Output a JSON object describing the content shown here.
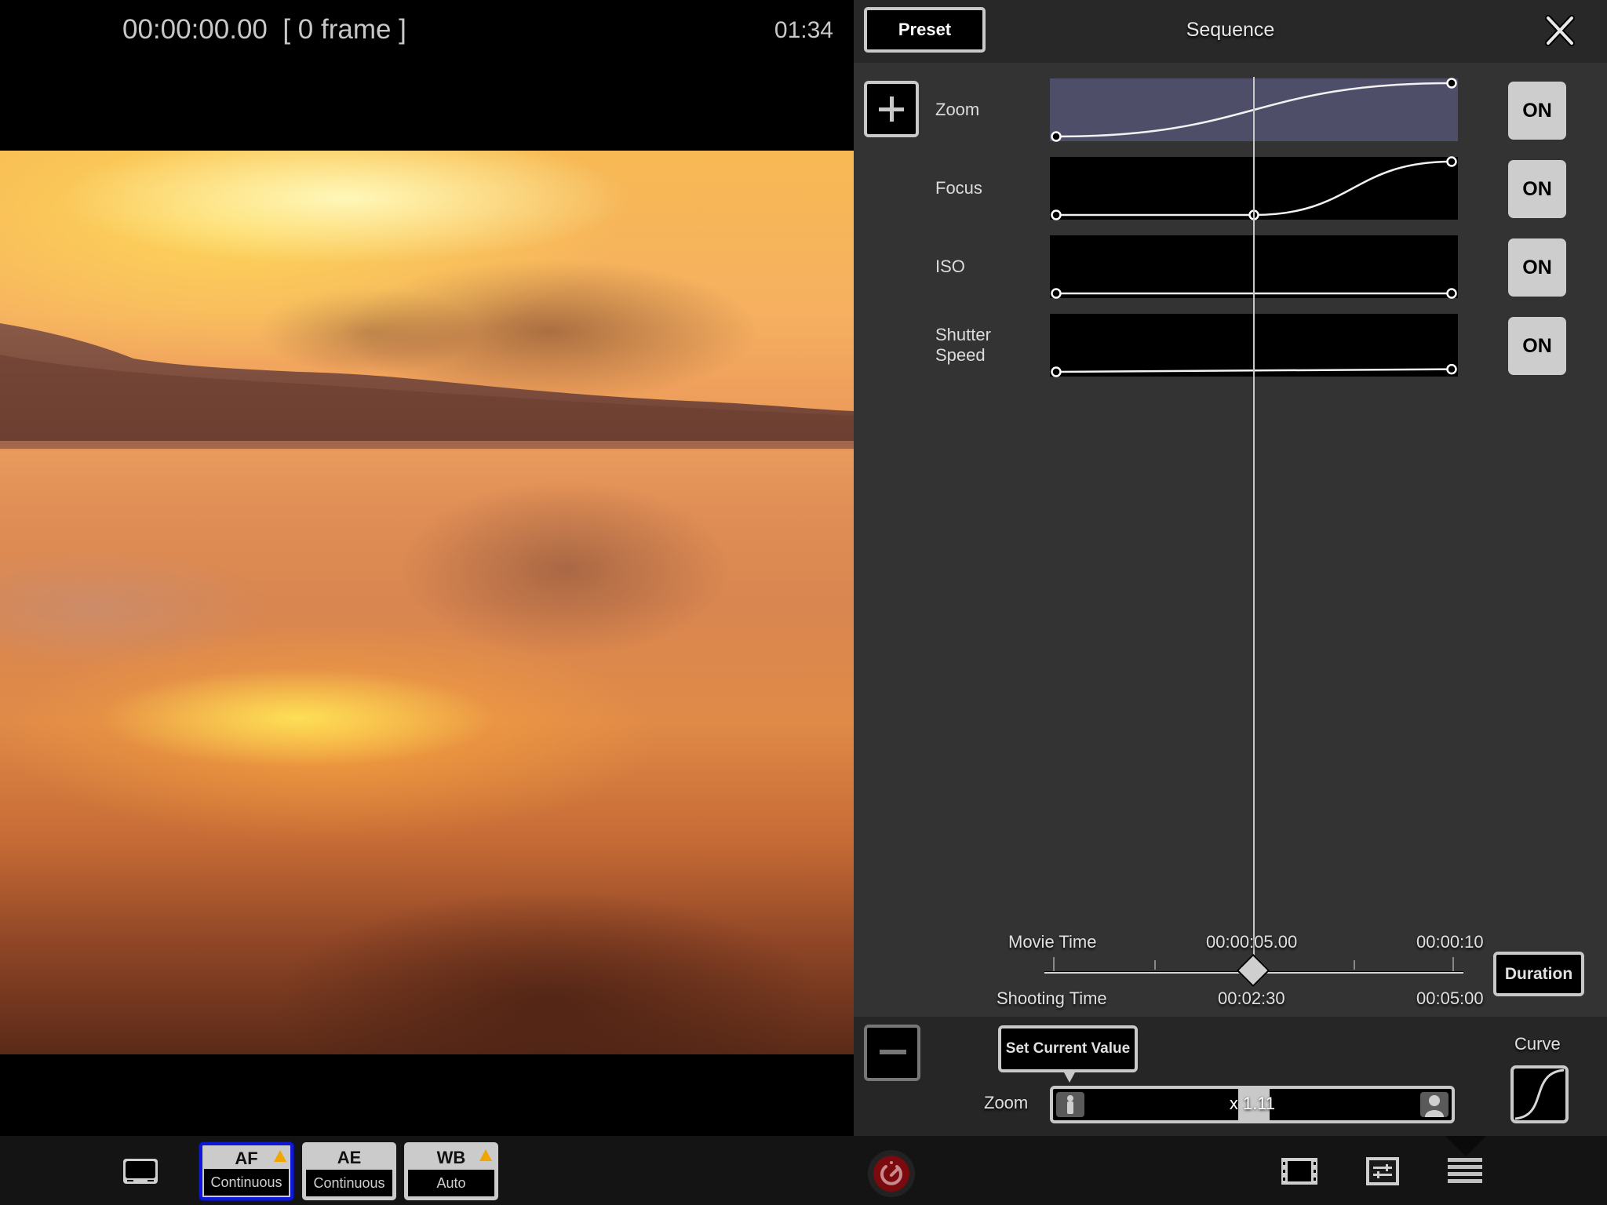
{
  "viewfinder": {
    "timecode": "00:00:00.00",
    "frame_count": "[ 0 frame ]",
    "remaining_time": "01:34",
    "image_description": "sunset over lake with forested hills and reflections"
  },
  "panel": {
    "title": "Sequence",
    "preset_label": "Preset",
    "close_icon": "close-icon",
    "add_icon": "plus-icon",
    "tracks": [
      {
        "label": "Zoom",
        "toggle": "ON",
        "selected": true,
        "keyframes": [
          {
            "t": 0.0,
            "v": 0.0
          },
          {
            "t": 1.0,
            "v": 1.0
          }
        ],
        "curve": "ease-in-out"
      },
      {
        "label": "Focus",
        "toggle": "ON",
        "selected": false,
        "keyframes": [
          {
            "t": 0.0,
            "v": 0.0
          },
          {
            "t": 0.5,
            "v": 0.0
          },
          {
            "t": 1.0,
            "v": 1.0
          }
        ],
        "curve": "ease-in-out"
      },
      {
        "label": "ISO",
        "toggle": "ON",
        "selected": false,
        "keyframes": [
          {
            "t": 0.0,
            "v": 0.0
          },
          {
            "t": 1.0,
            "v": 0.0
          }
        ],
        "curve": "linear"
      },
      {
        "label_line1": "Shutter",
        "label_line2": "Speed",
        "label": "Shutter Speed",
        "toggle": "ON",
        "selected": false,
        "keyframes": [
          {
            "t": 0.0,
            "v": 0.0
          },
          {
            "t": 1.0,
            "v": 0.05
          }
        ],
        "curve": "linear"
      }
    ],
    "playhead_position": 0.5,
    "timeline": {
      "movie_time_label": "Movie Time",
      "movie_time_current": "00:00:05.00",
      "movie_time_end": "00:00:10",
      "shooting_time_label": "Shooting Time",
      "shooting_time_current": "00:02:30",
      "shooting_time_end": "00:05:00",
      "duration_label": "Duration"
    },
    "controls": {
      "remove_icon": "minus-icon",
      "set_current_label": "Set Current Value",
      "param_label": "Zoom",
      "zoom_value": "x 1.11",
      "zoom_slider_position": 0.5,
      "curve_label": "Curve",
      "curve_icon": "s-curve-icon"
    }
  },
  "bottombar": {
    "monitor_icon": "monitor-icon",
    "modes": [
      {
        "name": "AF",
        "value": "Continuous",
        "warning": true,
        "active": true
      },
      {
        "name": "AE",
        "value": "Continuous",
        "warning": false,
        "active": false
      },
      {
        "name": "WB",
        "value": "Auto",
        "warning": true,
        "active": false
      }
    ],
    "record_icon": "timer-record-icon",
    "right_icons": [
      "film-icon",
      "settings-sliders-icon",
      "menu-icon"
    ]
  },
  "colors": {
    "accent_active": "#1018d8",
    "warning": "#f0a500",
    "selected_track": "#4f4e68",
    "record": "#7a0a0e"
  }
}
